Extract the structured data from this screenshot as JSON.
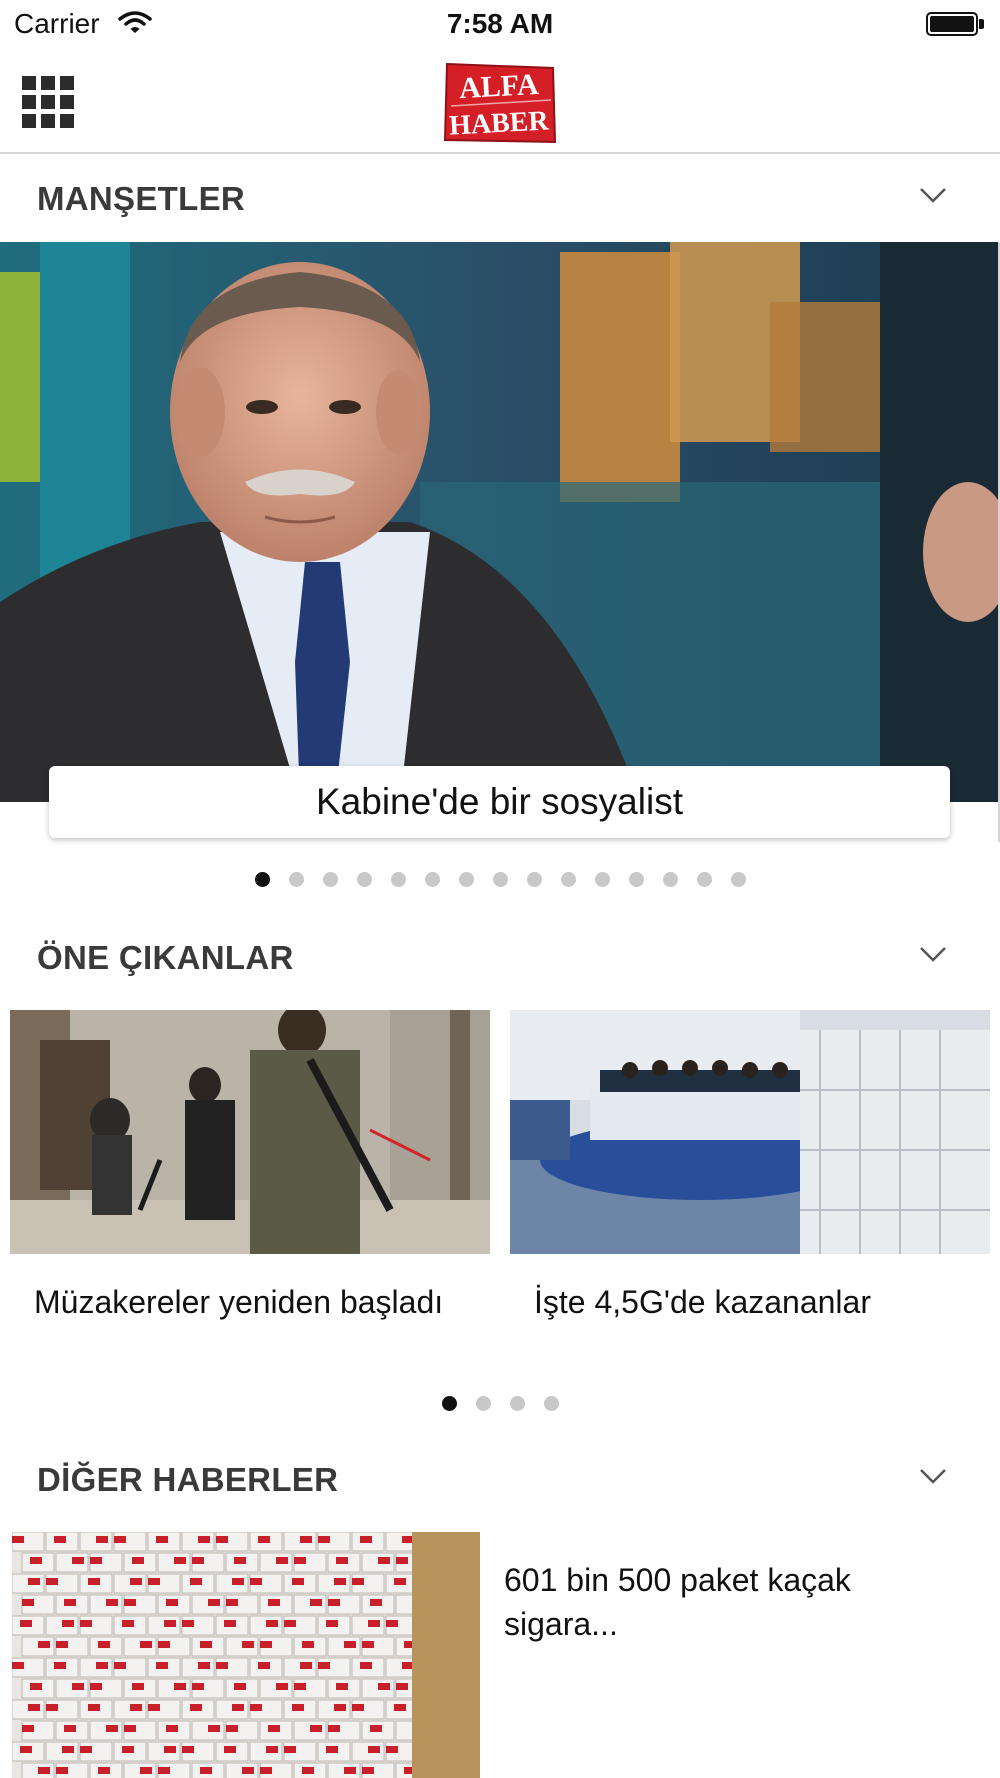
{
  "status_bar": {
    "carrier": "Carrier",
    "time": "7:58 AM",
    "wifi_icon": "wifi-icon",
    "battery_icon": "battery-icon"
  },
  "nav": {
    "menu_icon": "grid-menu-icon",
    "logo_line1": "ALFA",
    "logo_line2": "HABER",
    "logo_color": "#d51f26"
  },
  "sections": {
    "headlines": {
      "title": "MANŞETLER",
      "toggle_icon": "chevron-down-icon"
    },
    "featured": {
      "title": "ÖNE ÇIKANLAR",
      "toggle_icon": "chevron-down-icon"
    },
    "other": {
      "title": "DİĞER HABERLER",
      "toggle_icon": "chevron-down-icon"
    }
  },
  "hero": {
    "caption": "Kabine'de bir sosyalist",
    "page_count": 15,
    "current_page": 1
  },
  "featured_cards": [
    {
      "title": "Müzakereler yeniden başladı"
    },
    {
      "title": "İşte 4,5G'de kazananlar"
    }
  ],
  "featured_pager": {
    "page_count": 4,
    "current_page": 1
  },
  "other_news": [
    {
      "title": "601 bin 500 paket kaçak sigara..."
    }
  ]
}
